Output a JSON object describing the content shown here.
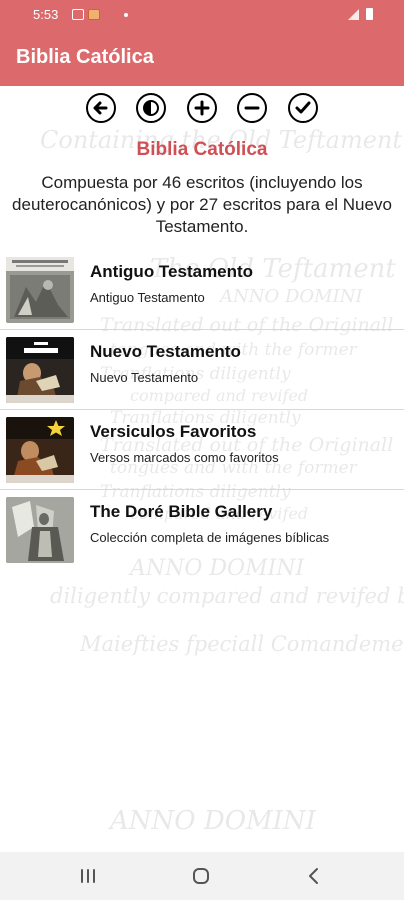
{
  "status_bar": {
    "time": "5:53",
    "icons": [
      "image-notification-icon",
      "app-notification-icon",
      "dot-icon",
      "signal-icon",
      "battery-icon"
    ]
  },
  "app_bar": {
    "title": "Biblia Católica",
    "color": "#dc6a6c"
  },
  "toolbar": {
    "buttons": [
      {
        "icon": "arrow-left-icon"
      },
      {
        "icon": "contrast-icon"
      },
      {
        "icon": "zoom-in-plus-icon"
      },
      {
        "icon": "zoom-out-minus-icon"
      },
      {
        "icon": "checkmark-icon"
      }
    ]
  },
  "heading": {
    "title": "Biblia Católica",
    "color": "#cf4f55",
    "description": "Compuesta por 46 escritos (incluyendo los deuterocanónicos) y por 27 escritos para el Nuevo Testamento."
  },
  "list": {
    "items": [
      {
        "title": "Antiguo Testamento",
        "subtitle": "Antiguo Testamento",
        "thumbnail": "old-testament-engraving"
      },
      {
        "title": "Nuevo Testamento",
        "subtitle": "Nuevo Testamento",
        "thumbnail": "new-testament-cover"
      },
      {
        "title": "Versiculos Favoritos",
        "subtitle": "Versos marcados como favoritos",
        "thumbnail": "favorites-cover-with-star"
      },
      {
        "title": "The Doré Bible Gallery",
        "subtitle": "Colección completa de imágenes bíblicas",
        "thumbnail": "dore-angel-engraving"
      }
    ]
  },
  "background": {
    "lines": [
      "Containing the Old Teftament",
      "The Old Teftament",
      "ANNO DOMINI",
      "Translated out of the Originall",
      "tongues and with the former",
      "Tranflations diligently",
      "compared and revifed",
      "Tranflations diligently",
      "Translated out of the Originall",
      "tongues and with the former",
      "Tranflations diligently",
      "compared and revifed",
      "ANNO DOMINI",
      "diligently compared and revifed by his",
      "Maiefties fpeciall Comandement",
      "ANNO DOMINI"
    ]
  },
  "nav_bar": {
    "buttons": [
      "recent-apps-icon",
      "home-icon",
      "back-icon"
    ]
  }
}
